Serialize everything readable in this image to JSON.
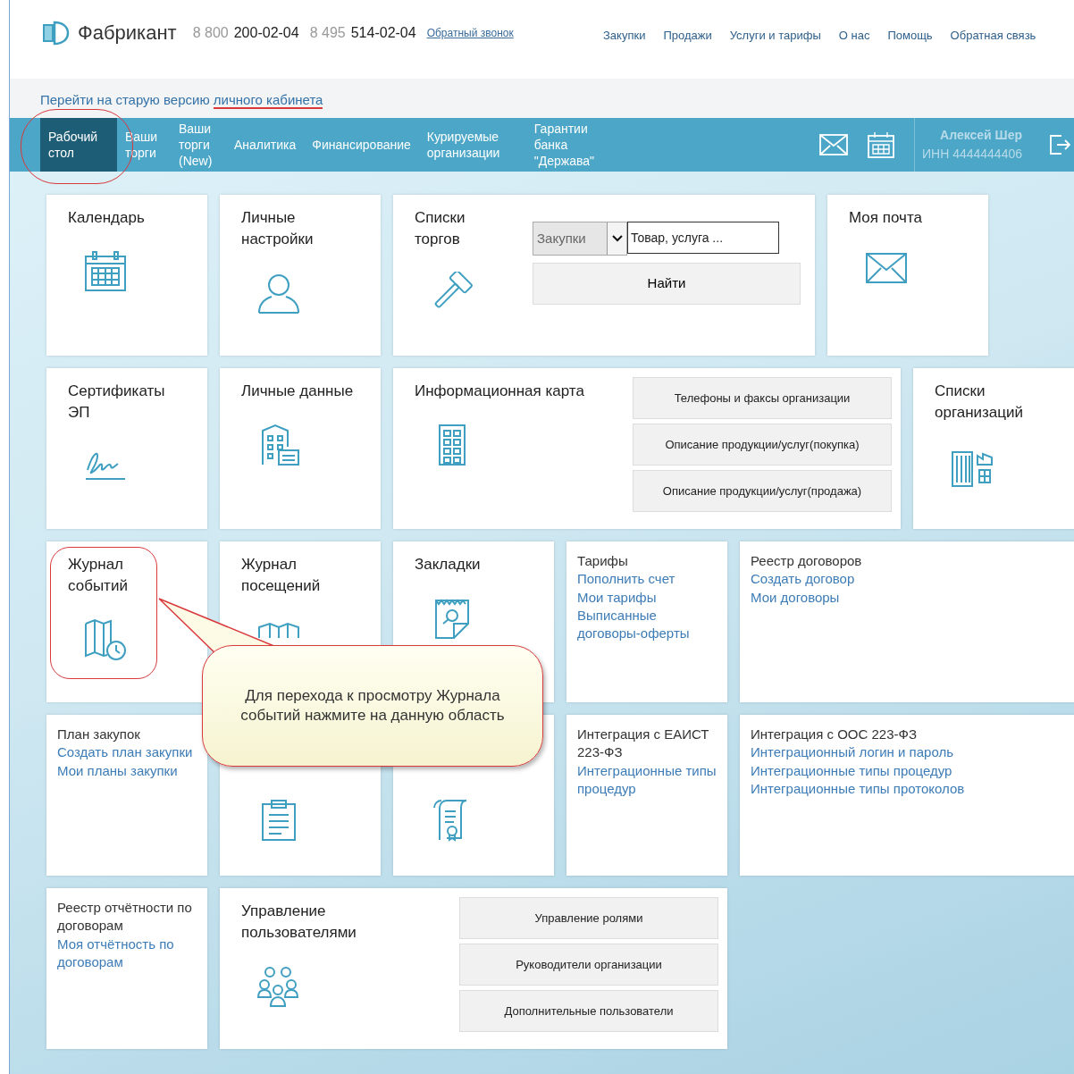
{
  "header": {
    "logo": "Фабрикант",
    "phones": [
      {
        "code": "8 800",
        "number": "200-02-04"
      },
      {
        "code": "8 495",
        "number": "514-02-04"
      }
    ],
    "callback_link": "Обратный звонок",
    "menu": [
      "Закупки",
      "Продажи",
      "Услуги и тарифы",
      "О нас",
      "Помощь",
      "Обратная связь"
    ]
  },
  "old_version_link": {
    "text": "Перейти на старую версию ",
    "marked": "личного кабинета"
  },
  "nav": {
    "items": [
      {
        "label": "Рабочий стол",
        "selected": true
      },
      {
        "label": "Ваши торги",
        "selected": false
      },
      {
        "label": "Ваши торги (New)",
        "selected": false
      },
      {
        "label": "Аналитика",
        "selected": false
      },
      {
        "label": "Финансирование",
        "selected": false
      },
      {
        "label": "Курируемые организации",
        "selected": false
      },
      {
        "label": "Гарантии банка \"Держава\"",
        "selected": false
      }
    ],
    "user": {
      "name": "Алексей Шер",
      "inn": "ИНН 4444444406"
    }
  },
  "tiles": [
    [
      {
        "kind": "icon",
        "title": "Календарь"
      },
      {
        "kind": "icon",
        "title": "Личные настройки"
      },
      {
        "kind": "search",
        "title": "Списки торгов",
        "select": "Закупки",
        "placeholder": "Товар, услуга ...",
        "button": "Найти"
      },
      {
        "kind": "icon",
        "title": "Моя почта"
      }
    ],
    [
      {
        "kind": "icon",
        "title": "Сертификаты ЭП"
      },
      {
        "kind": "icon",
        "title": "Личные данные"
      },
      {
        "kind": "buttons",
        "title": "Информационная карта",
        "buttons": [
          "Телефоны и факсы организации",
          "Описание продукции/услуг(покупка)",
          "Описание продукции/услуг(продажа)"
        ]
      },
      {
        "kind": "icon",
        "title": "Списки организаций"
      }
    ],
    [
      {
        "kind": "icon",
        "title": "Журнал событий"
      },
      {
        "kind": "icon",
        "title": "Журнал посещений"
      },
      {
        "kind": "icon",
        "title": "Закладки"
      },
      {
        "kind": "links",
        "title": "Тарифы",
        "links": [
          "Пополнить счет",
          "Мои тарифы",
          "Выписанные договоры-оферты"
        ]
      },
      {
        "kind": "links",
        "title": "Реестр договоров",
        "links": [
          "Создать договор",
          "Мои договоры"
        ]
      }
    ],
    [
      {
        "kind": "links",
        "title": "План закупок",
        "links": [
          "Создать план закупки",
          "Мои планы закупки"
        ]
      },
      {
        "kind": "icon"
      },
      {
        "kind": "icon"
      },
      {
        "kind": "links",
        "title": "Интеграция с ЕАИСТ 223-ФЗ",
        "links": [
          "Интеграционные типы процедур"
        ]
      },
      {
        "kind": "links",
        "title": "Интеграция с ООС 223-ФЗ",
        "links": [
          "Интеграционный логин и пароль",
          "Интеграционные типы процедур",
          "Интеграционные типы протоколов"
        ]
      }
    ],
    [
      {
        "kind": "links",
        "title": "Реестр отчётности по договорам",
        "links": [
          "Моя отчётность по договорам"
        ]
      },
      {
        "kind": "buttons",
        "title": "Управление пользователями",
        "buttons": [
          "Управление ролями",
          "Руководители организации",
          "Дополнительные пользователи"
        ]
      }
    ]
  ],
  "callout": {
    "text": "Для перехода к просмотру Журнала событий нажмите на данную область"
  }
}
